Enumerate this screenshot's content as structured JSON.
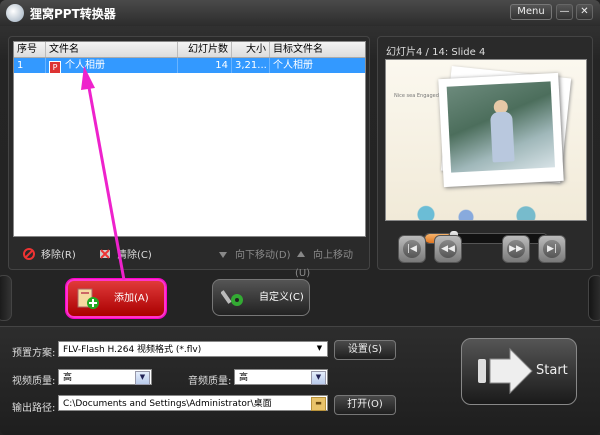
{
  "window": {
    "title": "狸窝PPT转换器",
    "menu_label": "Menu",
    "min_label": "—",
    "close_label": "✕"
  },
  "file_list": {
    "columns": [
      "序号",
      "文件名",
      "幻灯片数",
      "大小",
      "目标文件名"
    ],
    "rows": [
      {
        "index": "1",
        "filename": "个人相册",
        "slides": "14",
        "size": "3,21...",
        "target": "个人相册"
      }
    ]
  },
  "list_toolbar": {
    "remove": "移除(R)",
    "clear": "清除(C)",
    "move_down": "向下移动(D)",
    "move_up": "向上移动(U)"
  },
  "preview": {
    "slide_label": "幻灯片4 / 14: Slide 4",
    "slide_caption": "Nice sea Engaged to be a little Pine",
    "progress_fraction": 0.22
  },
  "actions": {
    "add_label": "添加(A)",
    "custom_label": "自定义(C)"
  },
  "settings": {
    "preset_label": "预置方案:",
    "preset_value": "FLV-Flash H.264 视频格式 (*.flv)",
    "setup_button": "设置(S)",
    "video_quality_label": "视频质量:",
    "video_quality_value": "高",
    "audio_quality_label": "音频质量:",
    "audio_quality_value": "高",
    "output_label": "输出路径:",
    "output_value": "C:\\Documents and Settings\\Administrator\\桌面",
    "open_button": "打开(O)"
  },
  "start": {
    "label": "Start"
  },
  "colors": {
    "accent_selection": "#3399ff",
    "add_button": "#d32020",
    "annotation_arrow": "#ee22cc"
  }
}
